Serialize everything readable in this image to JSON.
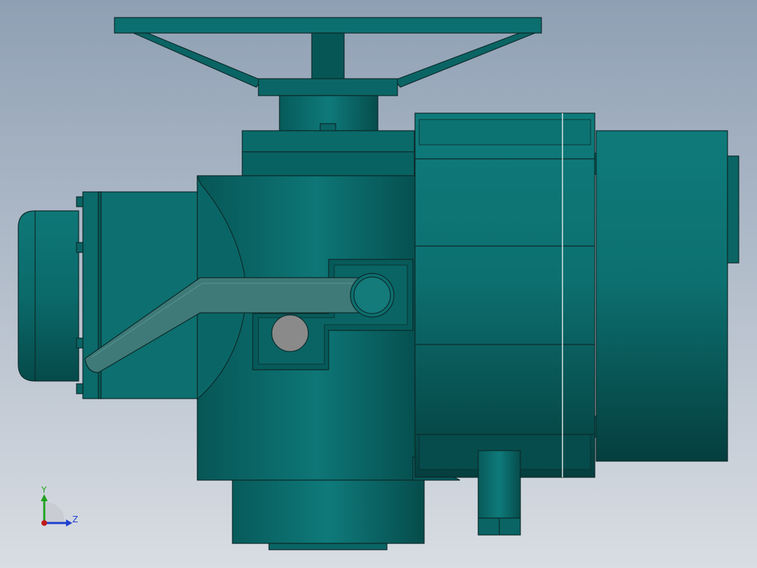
{
  "viewport": {
    "background_top": "#8fa0b4",
    "background_bottom": "#d9dde3"
  },
  "model": {
    "body_color": "#0a6b6b",
    "body_dark": "#054848",
    "body_light": "#138080",
    "handle_color": "#3f7a78",
    "window_color": "#8a8a8a",
    "outline_color": "#0c2a2a"
  },
  "triad": {
    "y_label": "Y",
    "z_label": "Z",
    "y_color": "#1fa21f",
    "z_color": "#1f3fd0",
    "origin_color": "#c01818"
  }
}
